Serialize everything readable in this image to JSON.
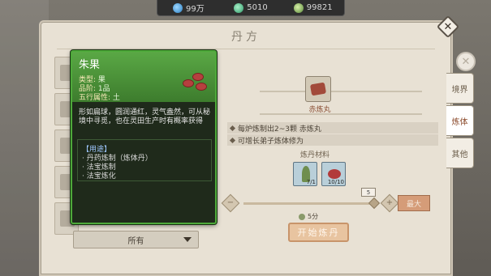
{
  "resources": [
    {
      "icon": "water-drop-icon",
      "value": "99万"
    },
    {
      "icon": "jade-icon",
      "value": "5010"
    },
    {
      "icon": "herb-icon",
      "value": "99821"
    }
  ],
  "panel": {
    "title": "丹方"
  },
  "tabs": [
    {
      "label": "境界"
    },
    {
      "label": "炼体"
    },
    {
      "label": "其他"
    }
  ],
  "filter": {
    "selected": "所有"
  },
  "recipe": {
    "pill_name": "赤炼丸",
    "effects": [
      "每炉炼制出2~3颗 赤炼丸",
      "可增长弟子炼体修为"
    ],
    "materials_title": "炼丹材料",
    "materials": [
      {
        "name": "herb",
        "qty": "7/1"
      },
      {
        "name": "zhuguo",
        "qty": "10/10"
      }
    ],
    "count": "5",
    "max_label": "最大",
    "time": "5分",
    "start_label": "开始炼丹"
  },
  "tooltip": {
    "name": "朱果",
    "type_label": "类型:",
    "type_value": "果",
    "grade_label": "品阶:",
    "grade_value": "1品",
    "element_label": "五行属性:",
    "element_value": "土",
    "description": "形如扁球，圆润通红，灵气盎然，可从秘境中寻觅，也在灵田生产时有概率获得",
    "use_title": "【用途】",
    "uses": [
      "· 丹药炼制（炼体丹）",
      "· 法宝炼制",
      "· 法宝炼化"
    ]
  }
}
